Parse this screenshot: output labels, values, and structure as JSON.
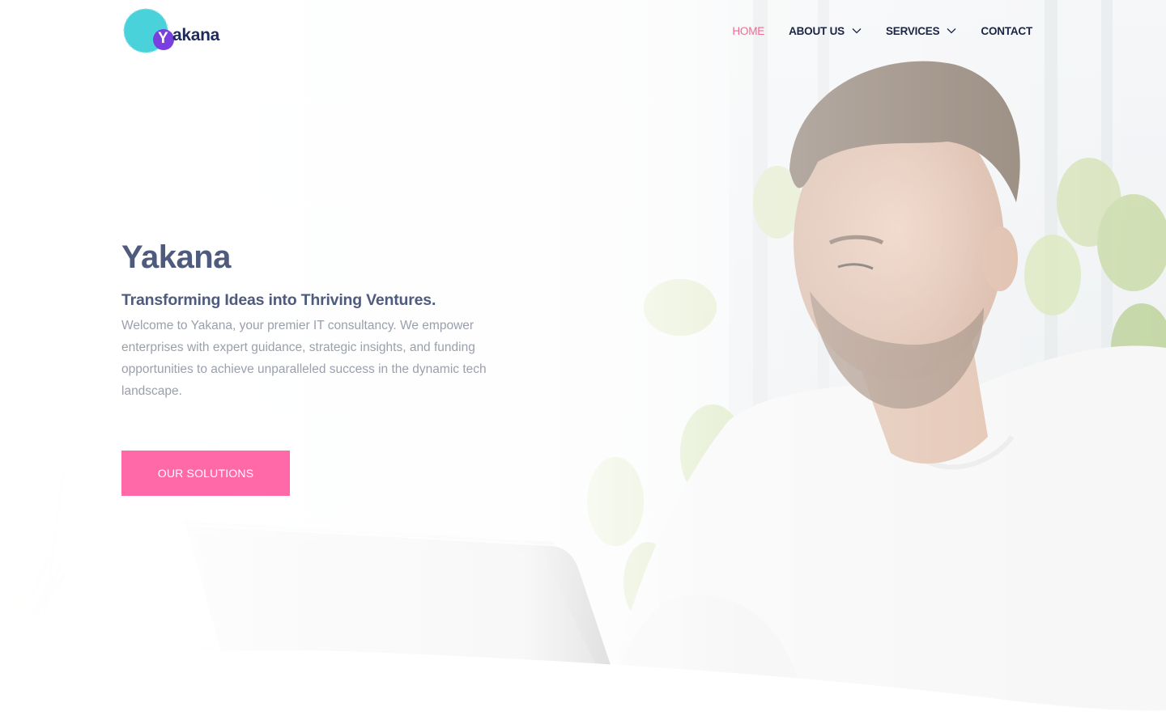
{
  "brand": {
    "name": "Yakana",
    "logo_letter": "Y",
    "logo_rest": "akana"
  },
  "nav": {
    "items": [
      {
        "label": "HOME",
        "active": true,
        "has_dropdown": false
      },
      {
        "label": "ABOUT US",
        "active": false,
        "has_dropdown": true
      },
      {
        "label": "SERVICES",
        "active": false,
        "has_dropdown": true
      },
      {
        "label": "CONTACT",
        "active": false,
        "has_dropdown": false
      }
    ]
  },
  "hero": {
    "title": "Yakana",
    "subtitle": "Transforming Ideas into Thriving Ventures.",
    "description": "Welcome to Yakana, your premier IT consultancy. We empower enterprises with expert guidance, strategic insights, and funding opportunities to achieve unparalleled success in the dynamic tech landscape.",
    "cta_label": "OUR SOLUTIONS"
  },
  "colors": {
    "accent_pink": "#ff69a8",
    "nav_active": "#ef6b91",
    "text_dark": "#1b2544",
    "heading": "#4f5b7d",
    "body_text": "#9aa0ab",
    "logo_teal": "#3fd0d8",
    "logo_purple": "#7a3fe0"
  },
  "icons": {
    "dropdown": "chevron-down-icon"
  }
}
